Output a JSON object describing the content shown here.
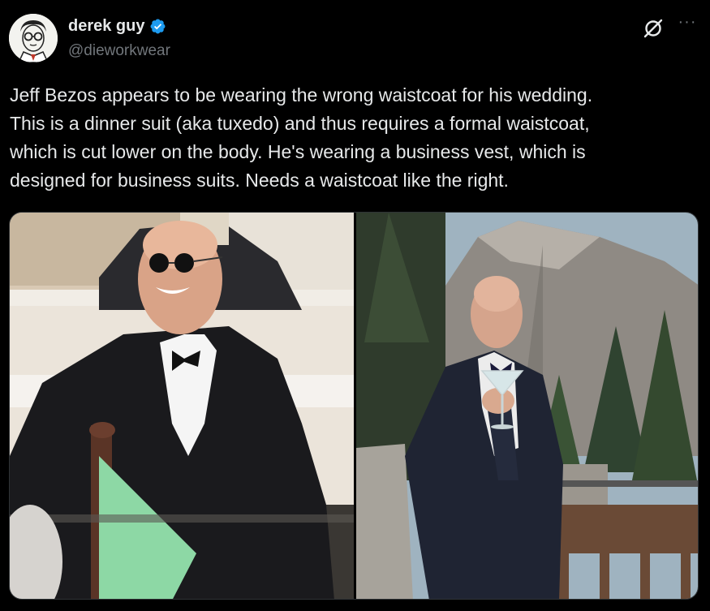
{
  "author": {
    "display_name": "derek guy",
    "handle": "@dieworkwear",
    "verified_icon": "verified-badge-icon",
    "avatar_icon": "avatar-illustration"
  },
  "actions": {
    "grok_icon": "grok-icon",
    "more_icon": "more-options-icon",
    "more_glyph": "···"
  },
  "tweet": {
    "lines": [
      "Jeff Bezos appears to be wearing the wrong waistcoat for his wedding.",
      "This is a dinner suit (aka tuxedo) and thus requires a formal waistcoat,",
      "which is cut lower on the body. He's wearing a business vest, which is",
      "designed for business suits. Needs a waistcoat like the right."
    ]
  },
  "media": {
    "images": [
      {
        "label": "photo-man-in-tuxedo-on-boat"
      },
      {
        "label": "photo-man-in-dinner-suit-holding-martini-with-mountain"
      }
    ]
  },
  "colors": {
    "background": "#000000",
    "text_primary": "#e7e9ea",
    "text_secondary": "#71767b",
    "verified_blue": "#1d9bf0",
    "border": "#2f3336"
  }
}
